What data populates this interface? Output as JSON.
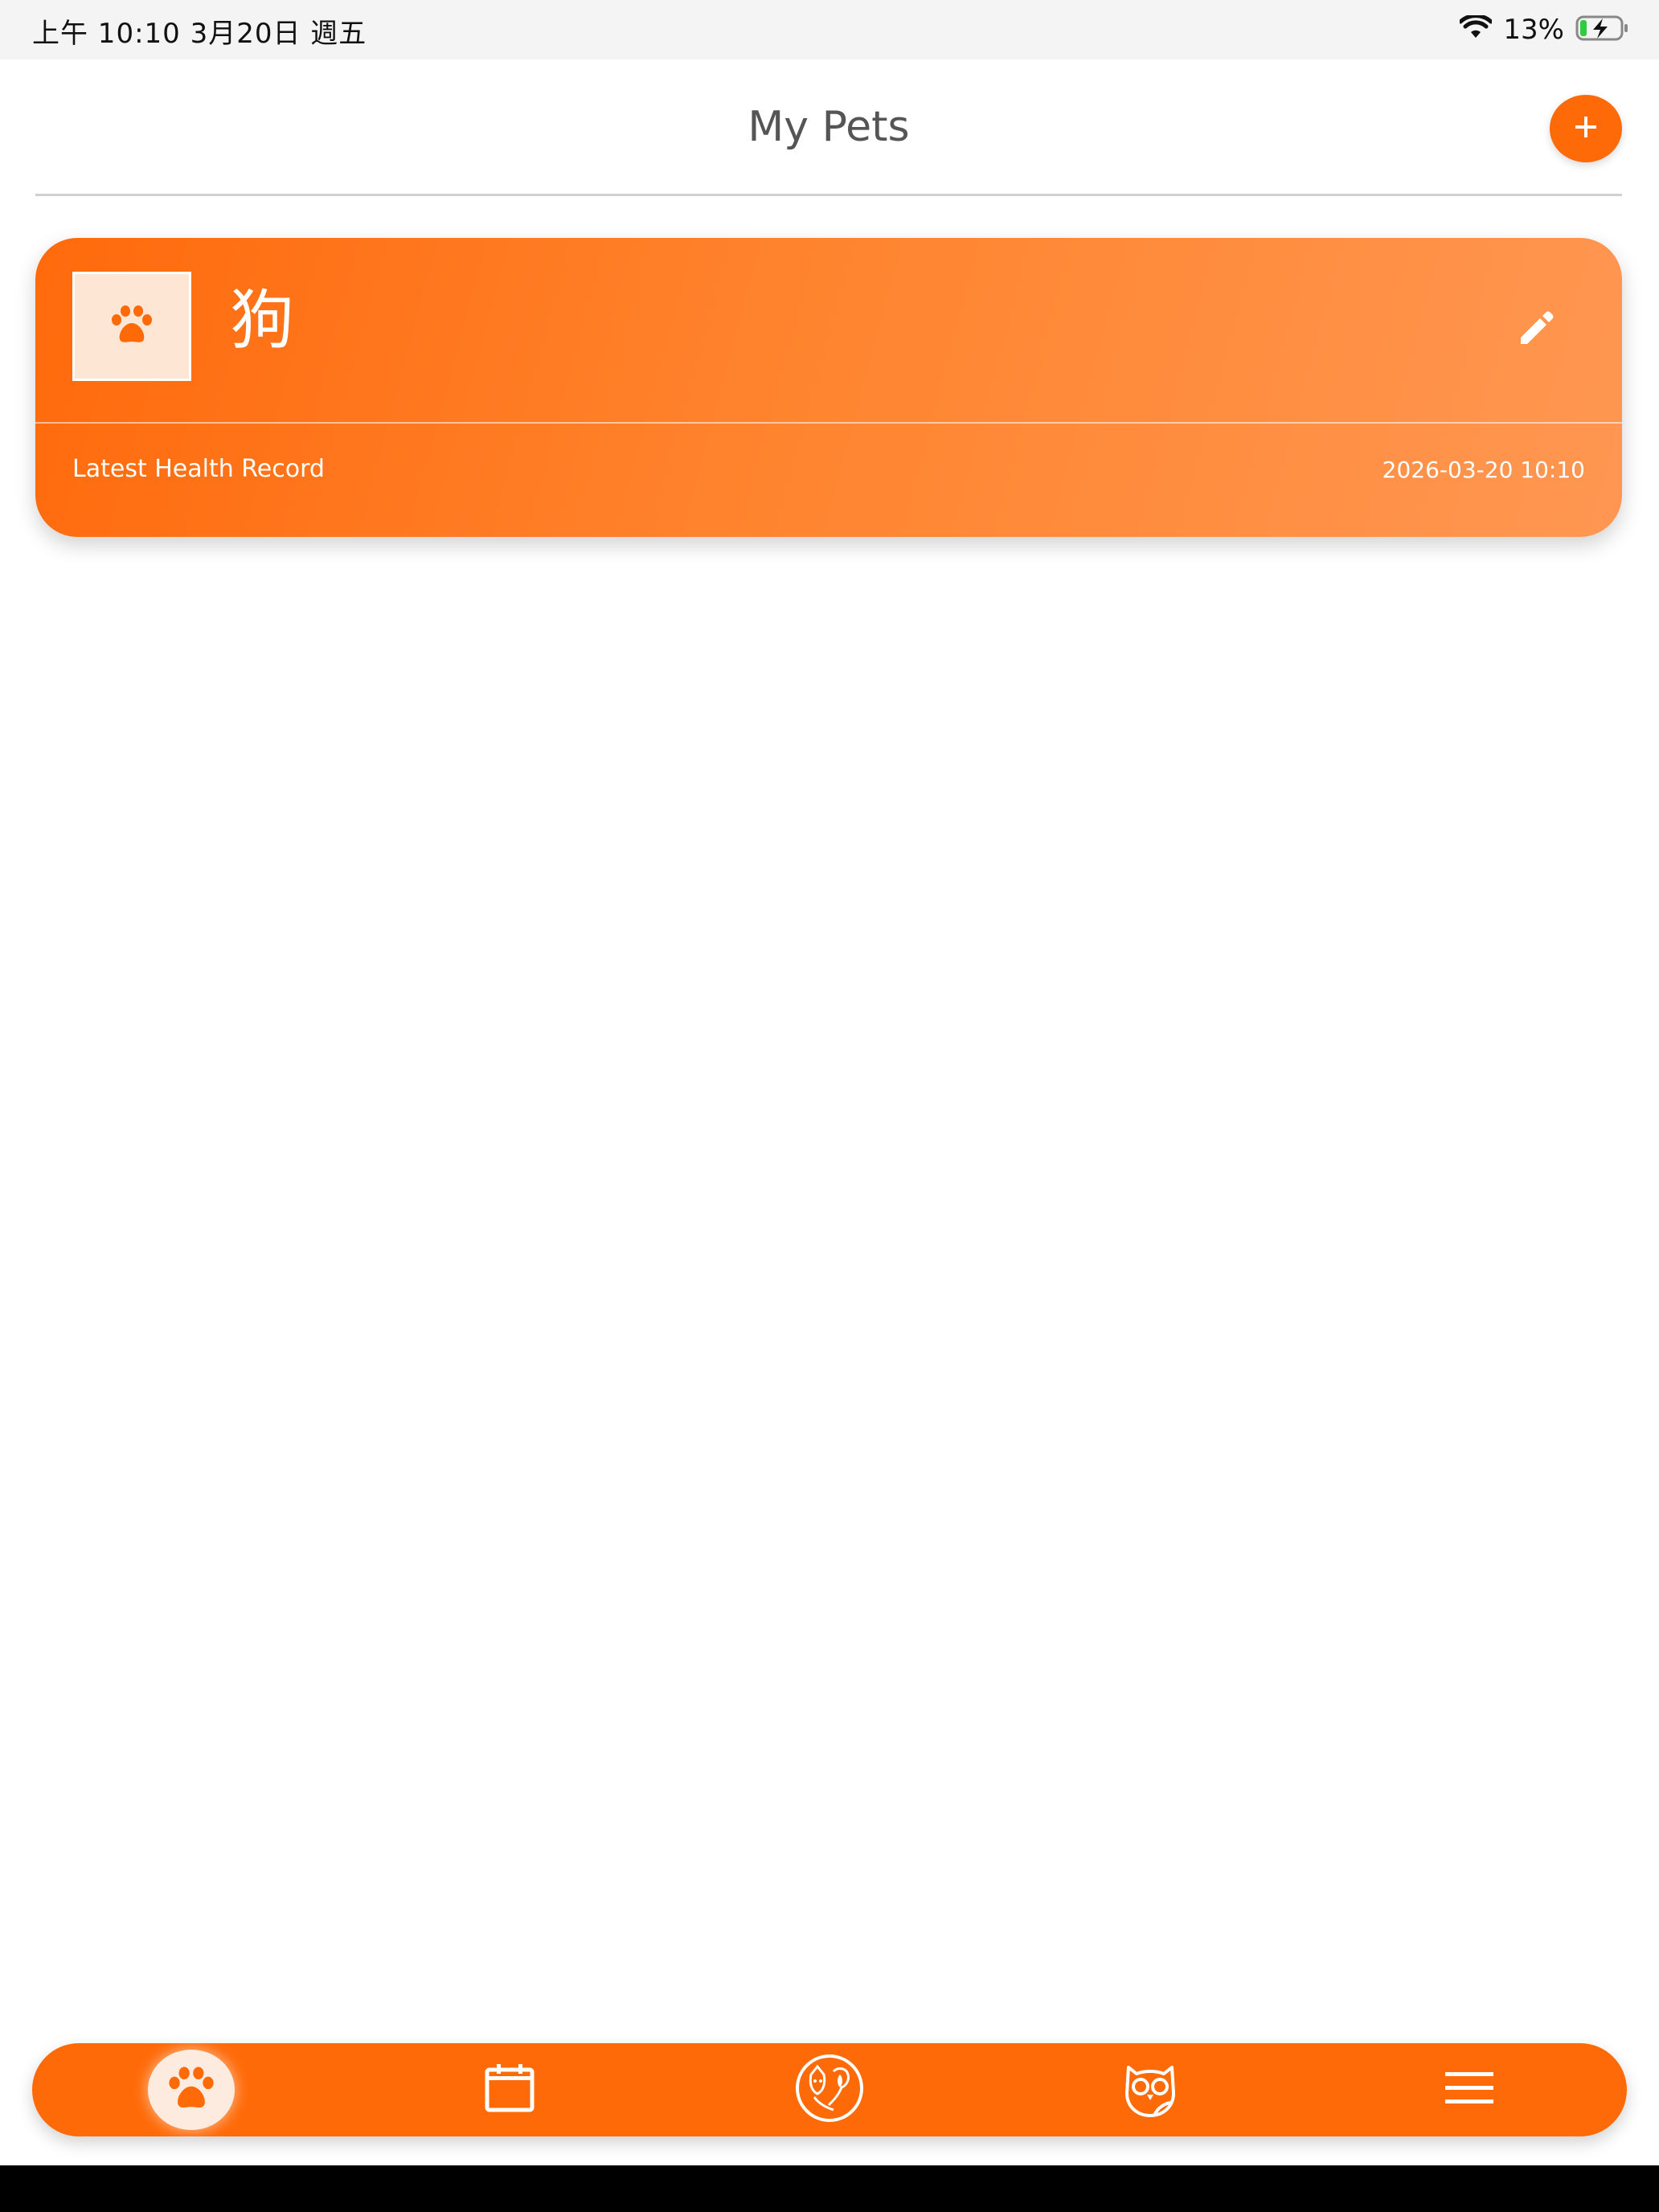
{
  "status_bar": {
    "time": "上午 10:10   3月20日 週五",
    "battery_percent": "13%",
    "icons": [
      "wifi-icon",
      "battery-charging-icon"
    ]
  },
  "header": {
    "title": "My Pets",
    "add_button_icon": "plus-icon"
  },
  "pets": [
    {
      "name": "狗",
      "avatar_icon": "paw-icon",
      "edit_icon": "pencil-icon",
      "record_label": "Latest Health Record",
      "record_date": "2026-03-20 10:10"
    }
  ],
  "tab_bar": {
    "active_index": 0,
    "tabs": [
      {
        "icon": "paw-icon"
      },
      {
        "icon": "calendar-icon"
      },
      {
        "icon": "pet-doctor-icon"
      },
      {
        "icon": "owl-icon"
      },
      {
        "icon": "menu-icon"
      }
    ]
  },
  "colors": {
    "accent": "#ff6a08",
    "card_gradient_start": "#ff6a0c",
    "card_gradient_end": "#ff9752",
    "avatar_bg": "#fde6d3"
  }
}
